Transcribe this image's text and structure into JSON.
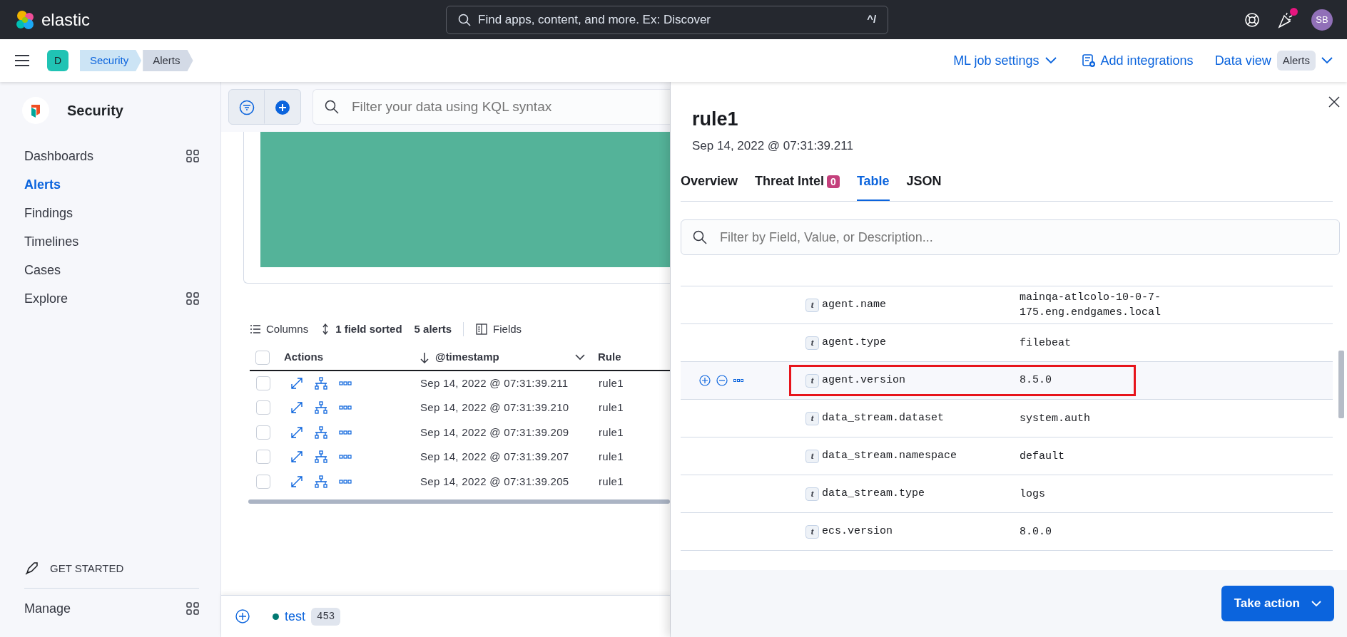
{
  "header": {
    "brand": "elastic",
    "search_placeholder": "Find apps, content, and more. Ex: Discover",
    "shortcut": "^/",
    "avatar": "SB",
    "notification": true
  },
  "breadcrumbs": {
    "space": "D",
    "items": [
      {
        "label": "Security",
        "selected": false
      },
      {
        "label": "Alerts",
        "selected": true
      }
    ]
  },
  "header_links": [
    {
      "label": "ML job settings",
      "kind": "dropdown"
    },
    {
      "label": "Add integrations",
      "kind": "integrations"
    }
  ],
  "data_view": {
    "label": "Data view",
    "value": "Alerts"
  },
  "sidebar": {
    "title": "Security",
    "items": [
      {
        "label": "Dashboards",
        "kind": "group",
        "selected": false
      },
      {
        "label": "Alerts",
        "kind": "link",
        "selected": true
      },
      {
        "label": "Findings",
        "kind": "link",
        "selected": false
      },
      {
        "label": "Timelines",
        "kind": "link",
        "selected": false
      },
      {
        "label": "Cases",
        "kind": "link",
        "selected": false
      },
      {
        "label": "Explore",
        "kind": "group",
        "selected": false
      }
    ],
    "get_started": "GET STARTED",
    "manage": "Manage"
  },
  "query": {
    "placeholder": "Filter your data using KQL syntax"
  },
  "toolbar": {
    "columns": "Columns",
    "sorted": "1 field sorted",
    "count": "5 alerts",
    "fields": "Fields"
  },
  "alerts_table": {
    "columns": [
      "Actions",
      "@timestamp",
      "Rule"
    ],
    "all_selected": false,
    "rows": [
      {
        "timestamp": "Sep 14, 2022 @ 07:31:39.211",
        "rule": "rule1",
        "checked": false
      },
      {
        "timestamp": "Sep 14, 2022 @ 07:31:39.210",
        "rule": "rule1",
        "checked": false
      },
      {
        "timestamp": "Sep 14, 2022 @ 07:31:39.209",
        "rule": "rule1",
        "checked": false
      },
      {
        "timestamp": "Sep 14, 2022 @ 07:31:39.207",
        "rule": "rule1",
        "checked": false
      },
      {
        "timestamp": "Sep 14, 2022 @ 07:31:39.205",
        "rule": "rule1",
        "checked": false
      }
    ]
  },
  "timeline": {
    "name": "test",
    "count": "453"
  },
  "flyout": {
    "title": "rule1",
    "subtitle": "Sep 14, 2022 @ 07:31:39.211",
    "tabs": [
      {
        "label": "Overview",
        "selected": false
      },
      {
        "label": "Threat Intel",
        "badge": "0",
        "selected": false
      },
      {
        "label": "Table",
        "selected": true
      },
      {
        "label": "JSON",
        "selected": false
      }
    ],
    "search_placeholder": "Filter by Field, Value, or Description...",
    "fields": [
      {
        "type_icon": "t",
        "field": "agent.name",
        "value": "mainqa-atlcolo-10-0-7-175.eng.endgames.local",
        "highlighted": false
      },
      {
        "type_icon": "t",
        "field": "agent.type",
        "value": "filebeat",
        "highlighted": false
      },
      {
        "type_icon": "t",
        "field": "agent.version",
        "value": "8.5.0",
        "highlighted": true
      },
      {
        "type_icon": "t",
        "field": "data_stream.dataset",
        "value": "system.auth",
        "highlighted": false
      },
      {
        "type_icon": "t",
        "field": "data_stream.namespace",
        "value": "default",
        "highlighted": false
      },
      {
        "type_icon": "t",
        "field": "data_stream.type",
        "value": "logs",
        "highlighted": false
      },
      {
        "type_icon": "t",
        "field": "ecs.version",
        "value": "8.0.0",
        "highlighted": false
      }
    ],
    "action_button": "Take action"
  }
}
